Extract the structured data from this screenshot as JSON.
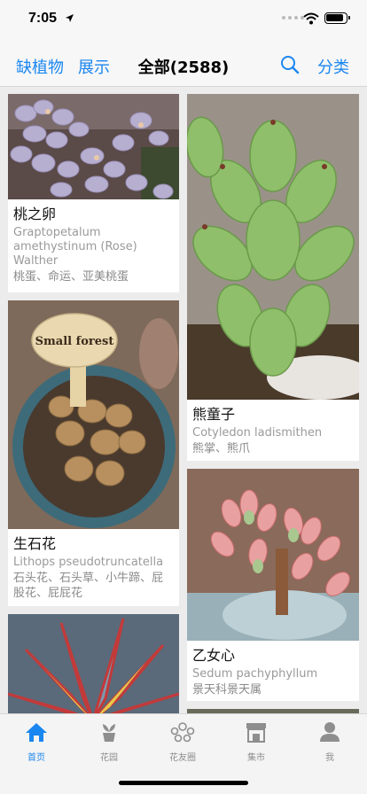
{
  "status": {
    "time": "7:05"
  },
  "nav": {
    "left1": "缺植物",
    "left2": "展示",
    "title": "全部(2588)",
    "right": "分类"
  },
  "plants": [
    {
      "name": "桃之卵",
      "latin": "Graptopetalum amethystinum (Rose) Walther",
      "alias": "桃蛋、命运、亚美桃蛋"
    },
    {
      "name": "熊童子",
      "latin": "Cotyledon ladismithen",
      "alias": "熊掌、熊爪"
    },
    {
      "name": "生石花",
      "latin": "Lithops pseudotruncatella",
      "alias": "石头花、石头草、小牛蹄、屁股花、屁屁花",
      "sign": "Small forest"
    },
    {
      "name": "乙女心",
      "latin": "Sedum pachyphyllum",
      "alias": "景天科景天属"
    }
  ],
  "tabs": [
    {
      "label": "首页",
      "icon": "home-icon"
    },
    {
      "label": "花园",
      "icon": "pot-plant-icon"
    },
    {
      "label": "花友圈",
      "icon": "friends-icon"
    },
    {
      "label": "集市",
      "icon": "shop-icon"
    },
    {
      "label": "我",
      "icon": "person-icon"
    }
  ],
  "colors": {
    "accent": "#1a86f0",
    "inactive": "#8e8e8e"
  }
}
